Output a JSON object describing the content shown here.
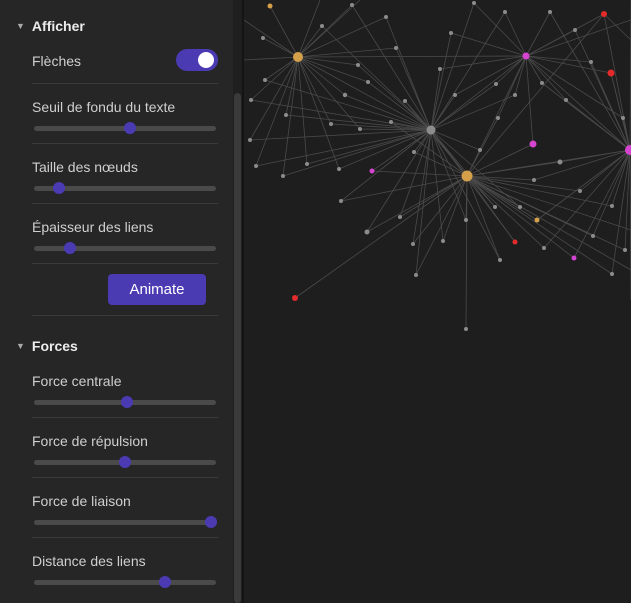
{
  "display": {
    "title": "Afficher",
    "arrows_label": "Flèches",
    "arrows_on": true,
    "text_fade_label": "Seuil de fondu du texte",
    "text_fade_value": 0.53,
    "node_size_label": "Taille des nœuds",
    "node_size_value": 0.14,
    "link_thickness_label": "Épaisseur des liens",
    "link_thickness_value": 0.2,
    "animate_label": "Animate"
  },
  "forces": {
    "title": "Forces",
    "center_label": "Force centrale",
    "center_value": 0.51,
    "repel_label": "Force de répulsion",
    "repel_value": 0.5,
    "link_label": "Force de liaison",
    "link_value": 0.97,
    "distance_label": "Distance des liens",
    "distance_value": 0.72
  },
  "colors": {
    "accent": "#4b3bb3",
    "node_default": "#8c8c8c",
    "node_tag": "#d4a04a",
    "node_attachment": "#d544d0",
    "node_unresolved": "#e32b2b",
    "link": "#4a4a4a"
  }
}
